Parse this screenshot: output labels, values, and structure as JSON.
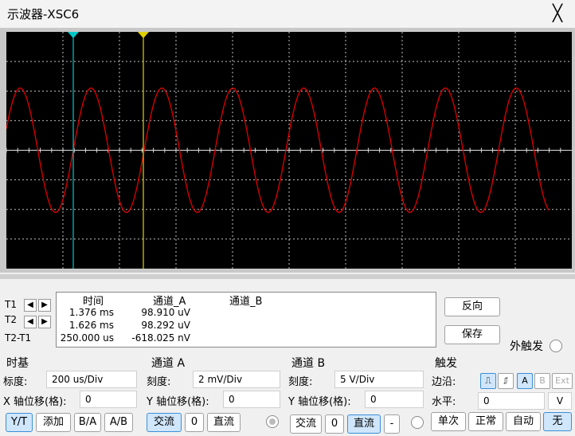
{
  "window": {
    "title": "示波器-XSC6",
    "close_glyph": "╳"
  },
  "display": {
    "trace_color": "#d40000",
    "cursor1_color": "#00c8c8",
    "cursor2_color": "#e0d000",
    "cycles_visible": 7.6
  },
  "readout": {
    "headers": [
      "时间",
      "通道_A",
      "通道_B"
    ],
    "row_labels": [
      "T1",
      "T2",
      "T2-T1"
    ],
    "rows": [
      {
        "time": "1.376 ms",
        "a": "98.910 uV",
        "b": ""
      },
      {
        "time": "1.626 ms",
        "a": "98.292 uV",
        "b": ""
      },
      {
        "time": "250.000 us",
        "a": "-618.025 nV",
        "b": ""
      }
    ],
    "reverse_button": "反向",
    "save_button": "保存",
    "ext_trigger_label": "外触发"
  },
  "timebase": {
    "title": "时基",
    "scale_label": "标度:",
    "scale_value": "200 us/Div",
    "xpos_label": "X 轴位移(格):",
    "xpos_value": "0",
    "modes": [
      "Y/T",
      "添加",
      "B/A",
      "A/B"
    ]
  },
  "channel_a": {
    "title": "通道 A",
    "scale_label": "刻度:",
    "scale_value": "2 mV/Div",
    "ypos_label": "Y 轴位移(格):",
    "ypos_value": "0",
    "coupling": [
      "交流",
      "0",
      "直流"
    ]
  },
  "channel_b": {
    "title": "通道 B",
    "scale_label": "刻度:",
    "scale_value": "5  V/Div",
    "ypos_label": "Y 轴位移(格):",
    "ypos_value": "0",
    "coupling": [
      "交流",
      "0",
      "直流"
    ],
    "minus": "-"
  },
  "trigger": {
    "title": "触发",
    "edge_label": "边沿:",
    "level_label": "水平:",
    "level_value": "0",
    "level_unit": "V",
    "sources": [
      "A",
      "B",
      "Ext"
    ],
    "modes": [
      "单次",
      "正常",
      "自动",
      "无"
    ]
  }
}
